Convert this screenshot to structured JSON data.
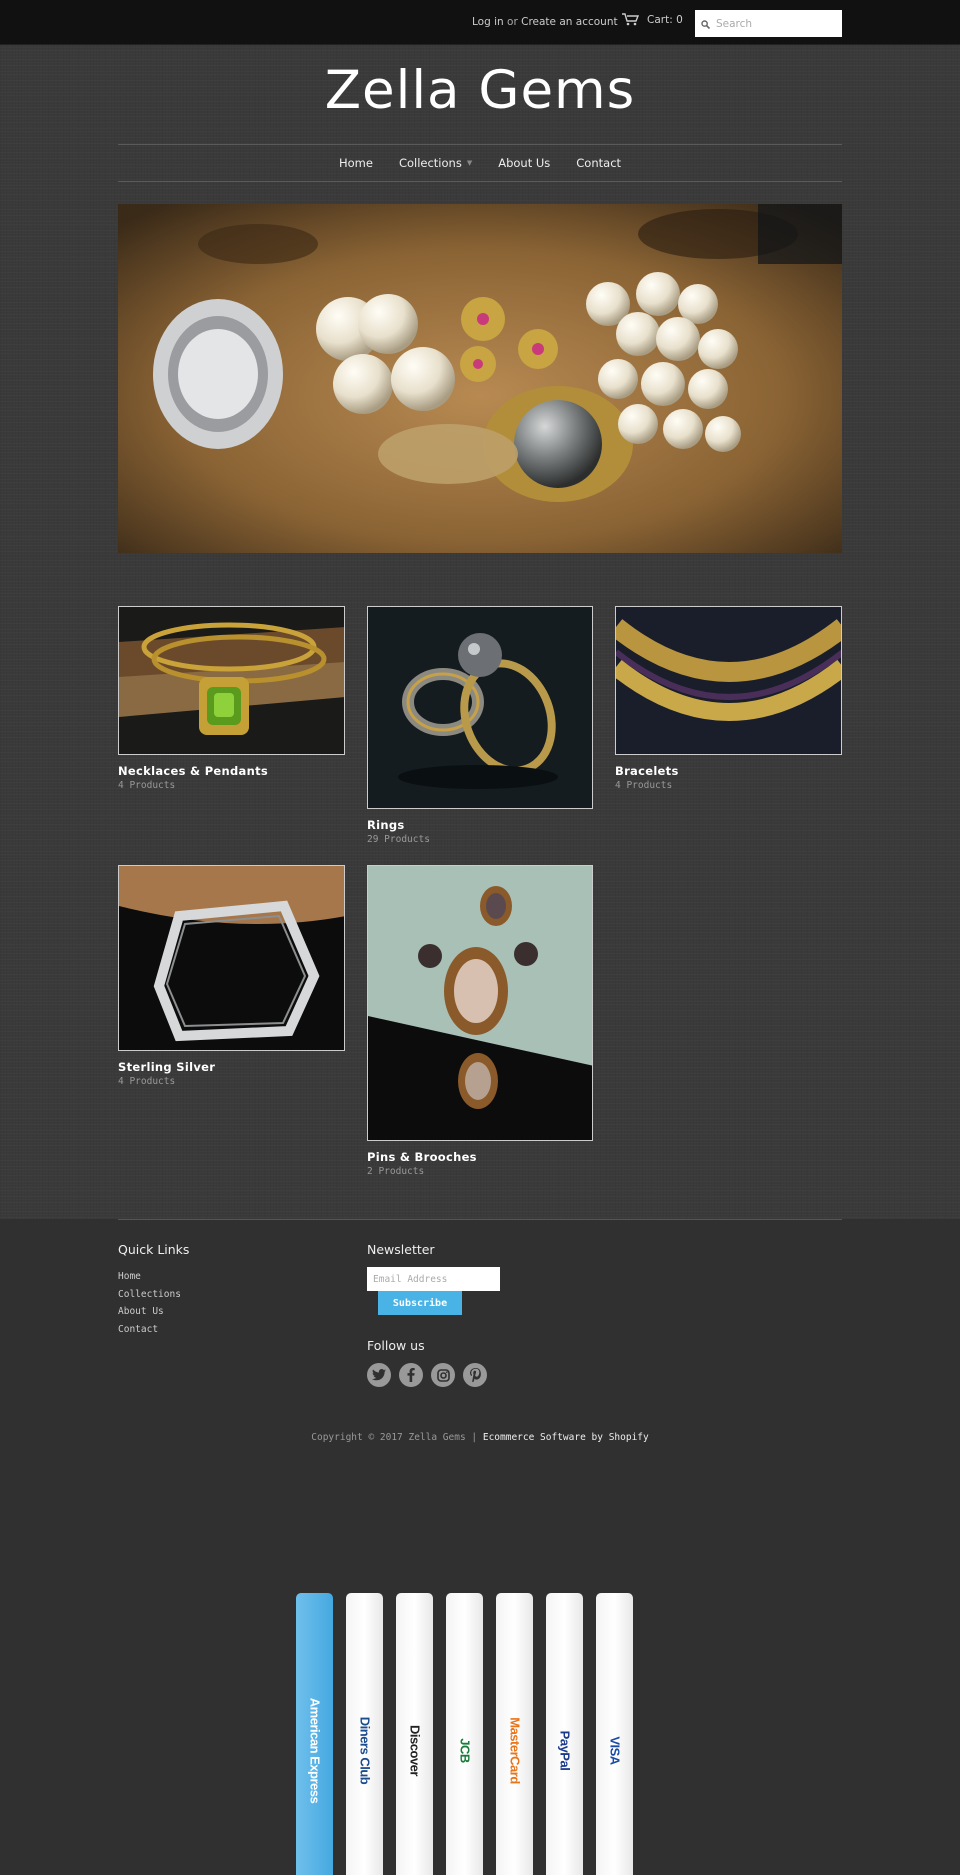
{
  "topbar": {
    "login": "Log in",
    "or": "or",
    "create_account": "Create an account",
    "cart": "Cart: 0",
    "search_placeholder": "Search"
  },
  "site": {
    "title": "Zella Gems"
  },
  "nav": {
    "items": [
      "Home",
      "Collections",
      "About Us",
      "Contact"
    ]
  },
  "collections": [
    {
      "title": "Necklaces & Pendants",
      "count": "4 Products"
    },
    {
      "title": "Rings",
      "count": "29 Products"
    },
    {
      "title": "Bracelets",
      "count": "4 Products"
    },
    {
      "title": "Sterling Silver",
      "count": "4 Products"
    },
    {
      "title": "Pins & Brooches",
      "count": "2 Products"
    }
  ],
  "footer": {
    "quick_links_title": "Quick Links",
    "quick_links": [
      "Home",
      "Collections",
      "About Us",
      "Contact"
    ],
    "newsletter_title": "Newsletter",
    "email_placeholder": "Email Address",
    "subscribe_label": "Subscribe",
    "follow_title": "Follow us",
    "social": [
      "twitter-icon",
      "facebook-icon",
      "instagram-icon",
      "pinterest-icon"
    ],
    "copyright": "Copyright © 2017 Zella Gems |",
    "shopify": "Ecommerce Software by Shopify",
    "payments": [
      "American Express",
      "Diners Club",
      "Discover",
      "JCB",
      "MasterCard",
      "PayPal",
      "VISA"
    ]
  },
  "colors": {
    "accent": "#4ab3e6",
    "topbar": "#111111",
    "footer": "#303030"
  }
}
